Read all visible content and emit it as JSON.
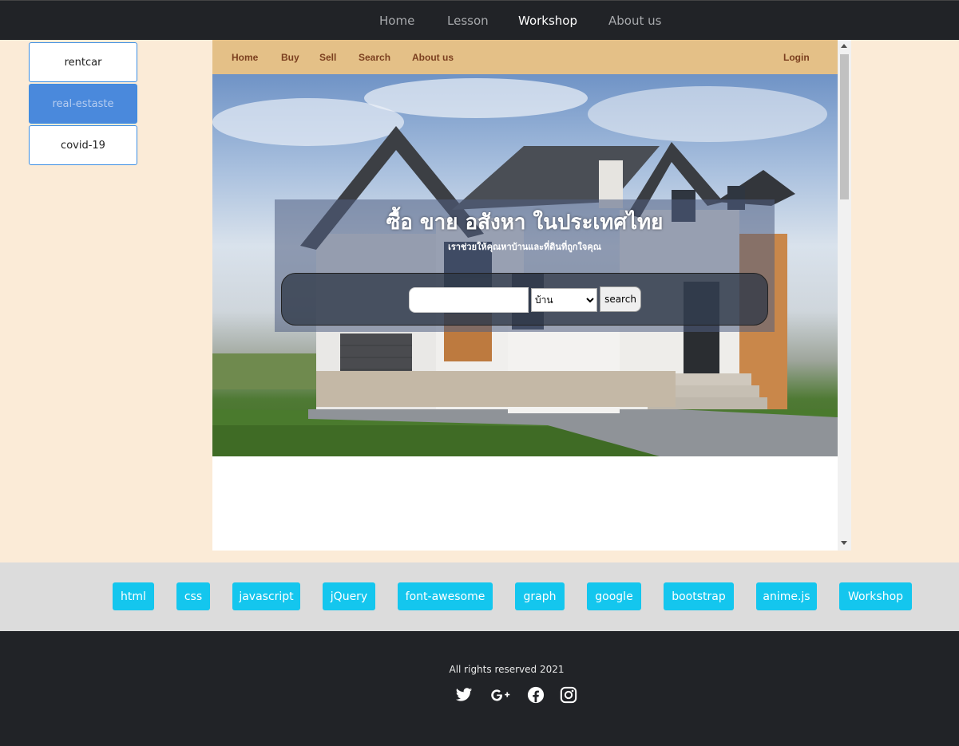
{
  "topnav": {
    "items": [
      {
        "label": "Home",
        "active": false
      },
      {
        "label": "Lesson",
        "active": false
      },
      {
        "label": "Workshop",
        "active": true
      },
      {
        "label": "About us",
        "active": false
      }
    ]
  },
  "sidebar": {
    "items": [
      {
        "label": "rentcar",
        "active": false
      },
      {
        "label": "real-estaste",
        "active": true
      },
      {
        "label": "covid-19",
        "active": false
      }
    ]
  },
  "site": {
    "nav": {
      "home": "Home",
      "buy": "Buy",
      "sell": "Sell",
      "search": "Search",
      "about": "About us",
      "login": "Login"
    },
    "hero": {
      "title": "ซื้อ ขาย อสังหา ในประเทศไทย",
      "subtitle": "เราช่วยให้คุณหาบ้านและที่ดินที่ถูกใจคุณ",
      "search_value": "",
      "select_value": "บ้าน",
      "search_button": "search"
    }
  },
  "tags": [
    "html",
    "css",
    "javascript",
    "jQuery",
    "font-awesome",
    "graph",
    "google",
    "bootstrap",
    "anime.js",
    "Workshop"
  ],
  "footer": {
    "copyright": "All rights reserved 2021",
    "social": [
      "twitter-icon",
      "google-plus-icon",
      "facebook-icon",
      "instagram-icon"
    ]
  },
  "colors": {
    "page_bg": "#fbebd7",
    "dark": "#212327",
    "subnav_bg": "#e4c087",
    "subnav_text": "#7b3f1f",
    "tag_bg": "#14c6ee",
    "active_side": "#4a89dc"
  }
}
